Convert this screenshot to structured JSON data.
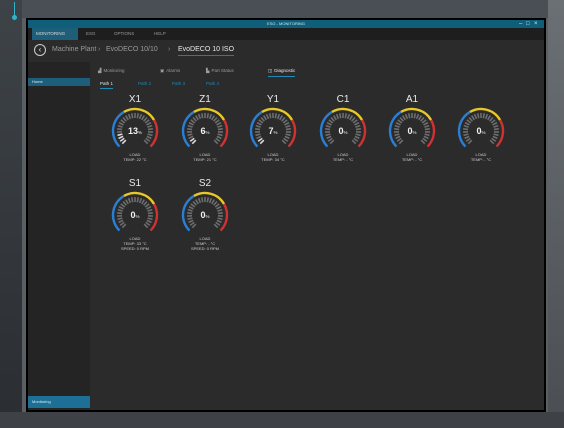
{
  "window": {
    "title": "ESG - MONITORING"
  },
  "menu": [
    {
      "label": "MONITORING",
      "active": true
    },
    {
      "label": "ESG",
      "active": false
    },
    {
      "label": "OPTIONS",
      "active": false
    },
    {
      "label": "HELP",
      "active": false
    }
  ],
  "breadcrumb": [
    {
      "label": "Machine Plant"
    },
    {
      "label": "EvoDECO 10/10"
    },
    {
      "label": "EvoDECO 10 ISO",
      "current": true
    }
  ],
  "sidebar": {
    "home_label": "Home",
    "monitoring_label": "Monitoring"
  },
  "tabs": [
    {
      "label": "Monitoring",
      "icon": "monitoring-icon"
    },
    {
      "label": "Alarms",
      "icon": "alarm-icon"
    },
    {
      "label": "Part Status",
      "icon": "part-status-icon"
    },
    {
      "label": "Diagnostic",
      "icon": "diagnostic-icon",
      "active": true
    }
  ],
  "paths": [
    {
      "label": "Path 1",
      "active": true
    },
    {
      "label": "Path 2"
    },
    {
      "label": "Path 3"
    },
    {
      "label": "Path 4"
    }
  ],
  "colors": {
    "accent": "#1f8ab5",
    "blue": "#2a7fd4",
    "yellow": "#e7c72a",
    "red": "#d23131"
  },
  "gauges": [
    {
      "axis": "X1",
      "load": 13,
      "value_text": "13",
      "unit": "%",
      "load_label": "LOAD",
      "temp": "TEMP: 22 °C",
      "speed": ""
    },
    {
      "axis": "Z1",
      "load": 6,
      "value_text": "6",
      "unit": "%",
      "load_label": "LOAD",
      "temp": "TEMP: 21 °C",
      "speed": ""
    },
    {
      "axis": "Y1",
      "load": 7,
      "value_text": "7",
      "unit": "%",
      "load_label": "LOAD",
      "temp": "TEMP: 34 °C",
      "speed": ""
    },
    {
      "axis": "C1",
      "load": 0,
      "value_text": "0",
      "unit": "%",
      "load_label": "LOAD",
      "temp": "TEMP: - °C",
      "speed": ""
    },
    {
      "axis": "A1",
      "load": 0,
      "value_text": "0",
      "unit": "%",
      "load_label": "LOAD",
      "temp": "TEMP: - °C",
      "speed": ""
    },
    {
      "axis": "",
      "load": 0,
      "value_text": "0",
      "unit": "%",
      "load_label": "LOAD",
      "temp": "TEMP: - °C",
      "speed": ""
    },
    {
      "axis": "S1",
      "load": 0,
      "value_text": "0",
      "unit": "%",
      "load_label": "LOAD",
      "temp": "TEMP: 33 °C",
      "speed": "SPEED: 0 RPM"
    },
    {
      "axis": "S2",
      "load": 0,
      "value_text": "0",
      "unit": "%",
      "load_label": "LOAD",
      "temp": "TEMP: - °C",
      "speed": "SPEED: 0 RPM"
    }
  ]
}
